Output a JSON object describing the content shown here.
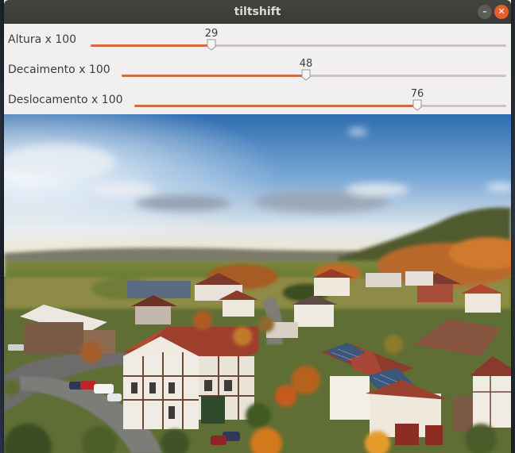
{
  "window": {
    "title": "tiltshift",
    "minimize_icon": "minimize-icon",
    "close_icon": "close-icon"
  },
  "sliders": [
    {
      "label": "Altura x 100",
      "value": 29,
      "min": 0,
      "max": 100
    },
    {
      "label": "Decaimento x 100",
      "value": 48,
      "min": 0,
      "max": 100
    },
    {
      "label": "Deslocamento x 100",
      "value": 76,
      "min": 0,
      "max": 100
    }
  ],
  "image": {
    "description_icon": "tilt-shift-photo"
  },
  "colors": {
    "accent": "#d06c45",
    "close_button": "#e85e2a",
    "titlebar": "#3e3e3a"
  }
}
